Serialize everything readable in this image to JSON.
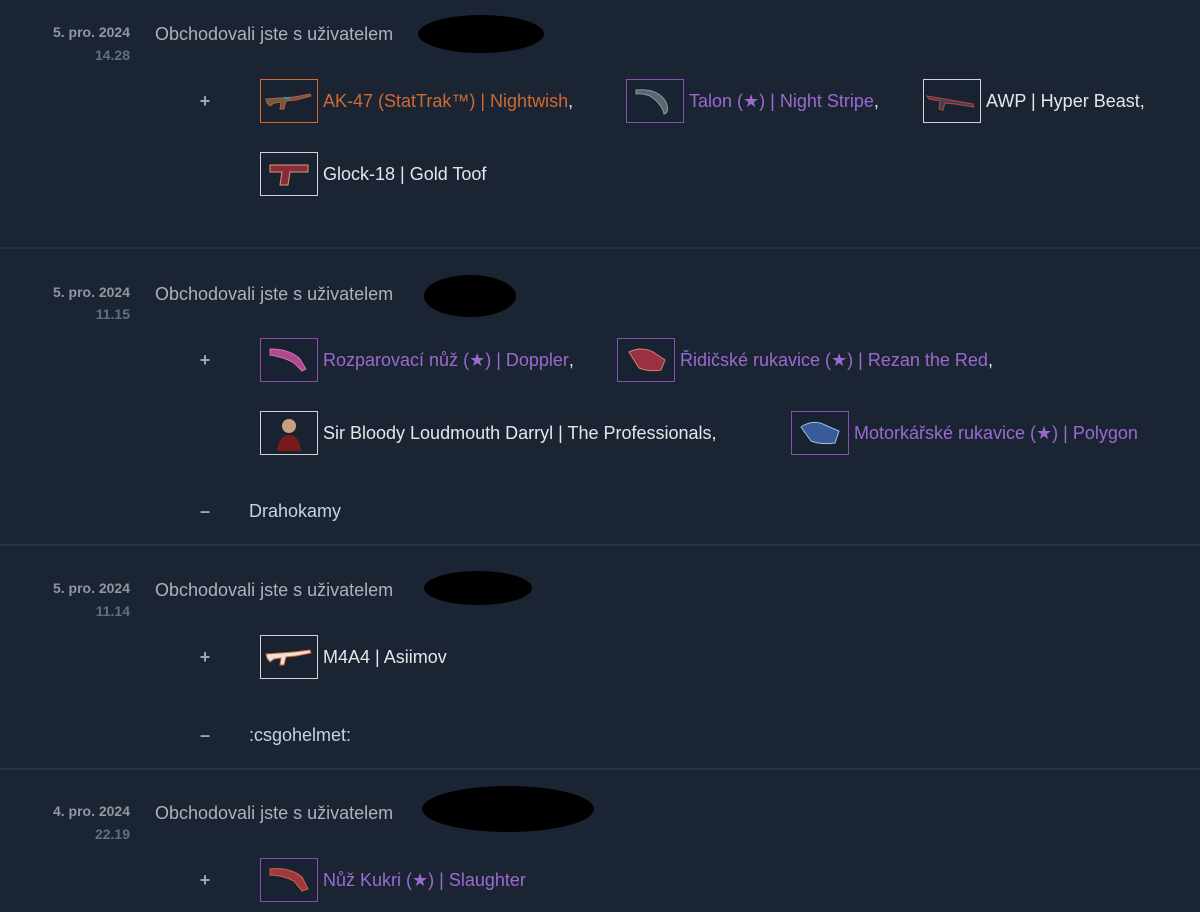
{
  "trades": [
    {
      "date": "5. pro. 2024",
      "time": "14.28",
      "description": "Obchodovali jste s uživatelem",
      "received": [
        {
          "name": "AK-47 (StatTrak™) | Nightwish",
          "suffix": ",",
          "rarity_color": "#cf6a32",
          "icon": "rifle-icon"
        },
        {
          "name": "Talon (★) | Night Stripe",
          "suffix": ",",
          "rarity_color": "#9b6ad0",
          "icon": "knife-icon"
        },
        {
          "name": "AWP | Hyper Beast",
          "suffix": ",",
          "rarity_color": "#e3e7ea",
          "icon": "sniper-rifle-icon"
        },
        {
          "name": "Glock-18 | Gold Toof",
          "suffix": "",
          "rarity_color": "#e3e7ea",
          "icon": "pistol-icon"
        }
      ]
    },
    {
      "date": "5. pro. 2024",
      "time": "11.15",
      "description": "Obchodovali jste s uživatelem",
      "received": [
        {
          "name": "Rozparovací nůž (★) | Doppler",
          "suffix": ",",
          "rarity_color": "#9b6ad0",
          "icon": "knife-icon"
        },
        {
          "name": "Řidičské rukavice (★) | Rezan the Red",
          "suffix": ",",
          "rarity_color": "#9b6ad0",
          "icon": "gloves-icon"
        },
        {
          "name": "Sir Bloody Loudmouth Darryl | The Professionals",
          "suffix": ",",
          "rarity_color": "#e3e7ea",
          "icon": "agent-icon"
        },
        {
          "name": "Motorkářské rukavice (★) | Polygon",
          "suffix": "",
          "rarity_color": "#9b6ad0",
          "icon": "gloves-icon"
        }
      ],
      "given": "Drahokamy"
    },
    {
      "date": "5. pro. 2024",
      "time": "11.14",
      "description": "Obchodovali jste s uživatelem",
      "received": [
        {
          "name": "M4A4 | Asiimov",
          "suffix": "",
          "rarity_color": "#e3e7ea",
          "icon": "rifle-icon"
        }
      ],
      "given": ":csgohelmet:"
    },
    {
      "date": "4. pro. 2024",
      "time": "22.19",
      "description": "Obchodovali jste s uživatelem",
      "received": [
        {
          "name": "Nůž Kukri (★) | Slaughter",
          "suffix": "",
          "rarity_color": "#9b6ad0",
          "icon": "knife-icon"
        }
      ]
    }
  ],
  "signs": {
    "plus": "+",
    "minus": "–"
  },
  "colors": {
    "background": "#1b2432",
    "covert": "#cf6a32",
    "rare": "#9b6ad0"
  }
}
